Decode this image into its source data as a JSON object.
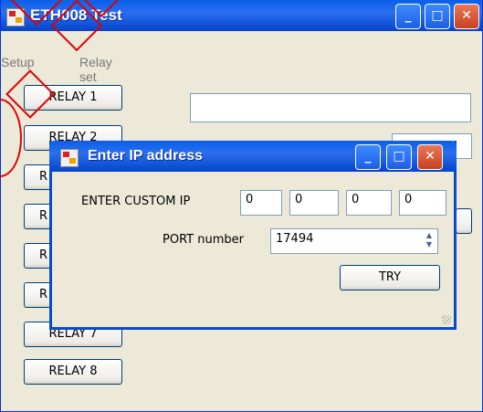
{
  "main_window": {
    "title": "ETH008 Test",
    "menu": [
      "Setup",
      "Relay set"
    ],
    "relay_buttons": [
      "RELAY 1",
      "RELAY 2",
      "R",
      "R",
      "R",
      "R",
      "RELAY 7",
      "RELAY 8"
    ],
    "controls": {
      "minimize": "_",
      "maximize": "□",
      "close": "✕"
    }
  },
  "dialog": {
    "title": "Enter IP address",
    "custom_ip_label": "ENTER CUSTOM IP",
    "ip_octets": [
      "0",
      "0",
      "0",
      "0"
    ],
    "port_label": "PORT number",
    "port_value": "17494",
    "try_label": "TRY"
  }
}
